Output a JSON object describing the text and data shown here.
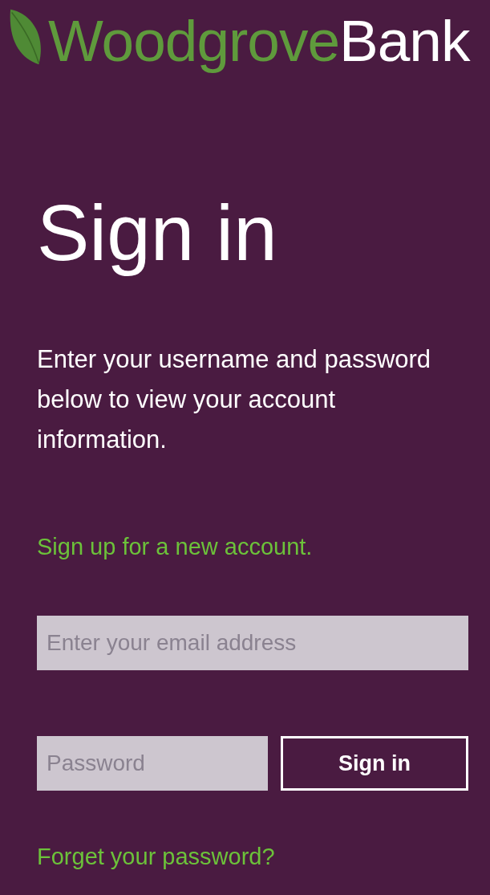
{
  "logo": {
    "brand_first": "Woodgrove",
    "brand_second": "Bank"
  },
  "heading": "Sign in",
  "description": "Enter your username and password below to view your account information.",
  "signup_link": "Sign up for a new account.",
  "email_field": {
    "placeholder": "Enter your email address"
  },
  "password_field": {
    "placeholder": "Password"
  },
  "sign_in_button": "Sign in",
  "forgot_link": "Forget your password?"
}
